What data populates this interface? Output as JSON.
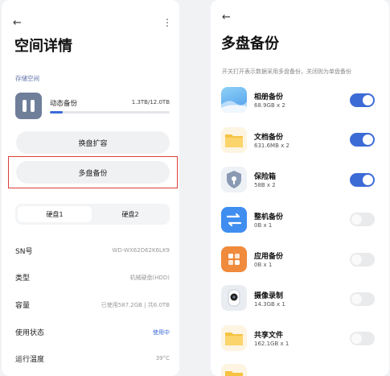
{
  "storage_detail": {
    "title": "空间详情",
    "section_label": "存储空间",
    "volume": {
      "name": "动态备份",
      "size": "1.3TB/12.0TB",
      "usage_fraction": 0.11
    },
    "expand_button": "换盘扩容",
    "multi_backup_button": "多盘备份",
    "disk_tabs": [
      "硬盘1",
      "硬盘2"
    ],
    "rows": [
      {
        "label": "SN号",
        "value": "WD-WX62D62K6LK9"
      },
      {
        "label": "类型",
        "value": "机械硬盘(HDD)"
      },
      {
        "label": "容量",
        "value": "已使用587.2GB | 共6.0TB"
      },
      {
        "label": "使用状态",
        "value": "使用中"
      },
      {
        "label": "运行温度",
        "value": "39°C"
      }
    ]
  },
  "multi_backup": {
    "title": "多盘备份",
    "subtitle": "开关打开表示数据采用多盘备份，关闭则为单盘备份",
    "items": [
      {
        "name": "相册备份",
        "detail": "68.9GB x 2",
        "on": true,
        "icon": "photo-album-icon"
      },
      {
        "name": "文档备份",
        "detail": "631.6MB x 2",
        "on": true,
        "icon": "folder-icon"
      },
      {
        "name": "保险箱",
        "detail": "58B x 2",
        "on": true,
        "icon": "safe-icon"
      },
      {
        "name": "整机备份",
        "detail": "0B x 1",
        "on": false,
        "icon": "transfer-icon"
      },
      {
        "name": "应用备份",
        "detail": "0B x 1",
        "on": false,
        "icon": "apps-icon"
      },
      {
        "name": "摄像录制",
        "detail": "14.3GB x 1",
        "on": false,
        "icon": "camera-icon"
      },
      {
        "name": "共享文件",
        "detail": "162.1GB x 1",
        "on": false,
        "icon": "shared-folder-icon"
      }
    ]
  },
  "icons": {
    "back": "back-arrow-icon",
    "more": "more-vertical-icon"
  },
  "colors": {
    "accent": "#3c6bd6",
    "highlight_border": "#d9403a"
  }
}
